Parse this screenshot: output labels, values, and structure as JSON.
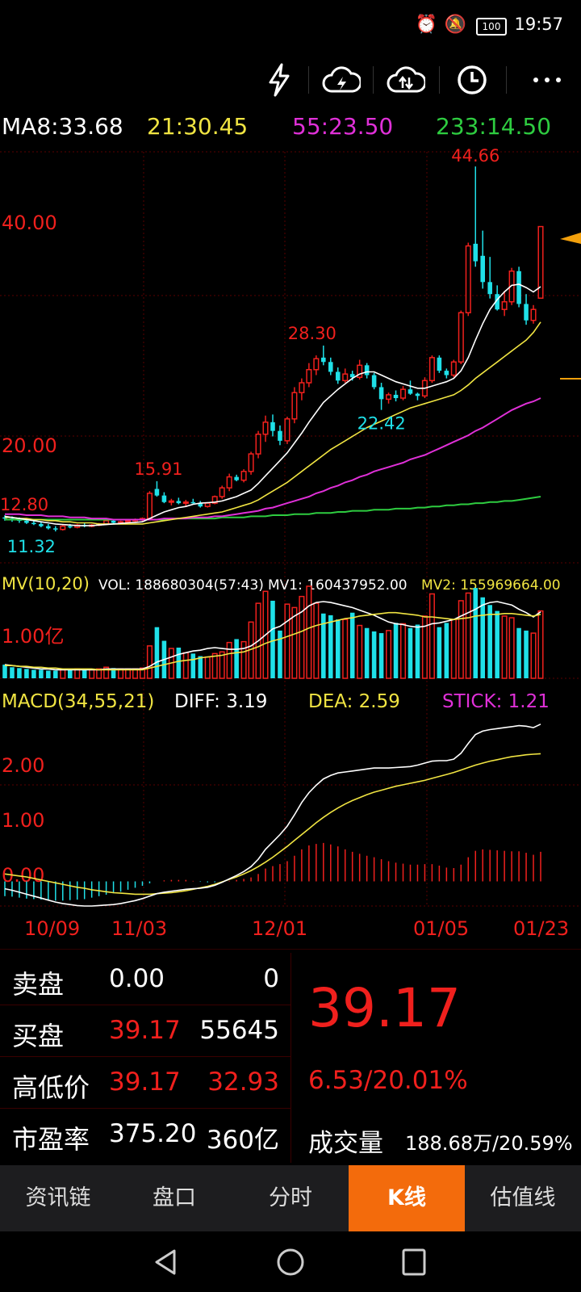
{
  "status": {
    "time": "19:57",
    "battery": "100"
  },
  "toolbar": {
    "icons": [
      "flash-icon",
      "cloud-lightning-icon",
      "cloud-sync-icon",
      "clock-icon",
      "more-icon"
    ]
  },
  "ma_legend": {
    "ma8": "MA8:33.68",
    "ma21": "21:30.45",
    "ma55": "55:23.50",
    "ma233": "233:14.50"
  },
  "price_axis": {
    "top": "40.00",
    "mid": "20.00"
  },
  "annotations": {
    "high": "44.66",
    "peak1": "28.30",
    "low1": "22.42",
    "peak0": "15.91",
    "start": "12.80",
    "low0": "11.32"
  },
  "volume": {
    "title": "MV(10,20)",
    "vol": "VOL: 188680304(57:43)",
    "mv1": "MV1: 160437952.00",
    "mv2": "MV2: 155969664.00",
    "axis": "1.00亿"
  },
  "macd": {
    "title": "MACD(34,55,21)",
    "diff": "DIFF: 3.19",
    "dea": "DEA: 2.59",
    "stick": "STICK: 1.21",
    "axis": [
      "2.00",
      "1.00",
      "0.00"
    ]
  },
  "dates": [
    "10/09",
    "11/03",
    "12/01",
    "01/05",
    "01/23"
  ],
  "quote": {
    "rows": [
      {
        "label": "卖盘",
        "v1": "0.00",
        "v2": "0"
      },
      {
        "label": "买盘",
        "v1": "39.17",
        "v2": "55645"
      },
      {
        "label": "高低价",
        "v1": "39.17",
        "v2": "32.93"
      },
      {
        "label": "市盈率",
        "v1": "375.20",
        "v2": "360亿"
      }
    ],
    "price": "39.17",
    "change": "6.53/20.01%",
    "volume_label": "成交量",
    "volume_value": "188.68万/20.59%"
  },
  "tabs": [
    "资讯链",
    "盘口",
    "分时",
    "K线",
    "估值线"
  ],
  "active_tab": 3,
  "colors": {
    "up": "#f0201d",
    "down": "#1fe0e8",
    "ma21": "#f0e442",
    "ma55": "#e030d8",
    "ma233": "#2ecc40",
    "accent": "#f36b0c"
  },
  "chart_data": {
    "type": "candlestick",
    "ylim": [
      10,
      46
    ],
    "candles": [
      [
        12.6,
        12.8,
        12.3,
        12.5
      ],
      [
        12.5,
        12.7,
        12.2,
        12.4
      ],
      [
        12.4,
        12.6,
        12.1,
        12.3
      ],
      [
        12.3,
        12.5,
        12.0,
        12.1
      ],
      [
        12.1,
        12.3,
        11.9,
        12.0
      ],
      [
        12.0,
        12.2,
        11.7,
        11.8
      ],
      [
        11.8,
        12.0,
        11.5,
        11.6
      ],
      [
        11.6,
        11.8,
        11.32,
        11.5
      ],
      [
        11.5,
        11.9,
        11.4,
        11.8
      ],
      [
        11.8,
        12.0,
        11.6,
        11.7
      ],
      [
        11.7,
        12.0,
        11.6,
        11.9
      ],
      [
        11.9,
        12.1,
        11.7,
        11.8
      ],
      [
        11.8,
        12.0,
        11.7,
        11.9
      ],
      [
        11.9,
        12.1,
        11.8,
        12.0
      ],
      [
        12.0,
        12.4,
        11.9,
        12.3
      ],
      [
        12.3,
        12.4,
        12.0,
        12.1
      ],
      [
        12.1,
        12.3,
        12.0,
        12.2
      ],
      [
        12.2,
        12.4,
        12.1,
        12.3
      ],
      [
        12.3,
        12.5,
        12.1,
        12.4
      ],
      [
        12.4,
        12.6,
        12.2,
        12.5
      ],
      [
        12.5,
        15.0,
        12.4,
        14.8
      ],
      [
        15.2,
        15.91,
        14.5,
        14.6
      ],
      [
        14.6,
        14.9,
        13.9,
        14.0
      ],
      [
        14.0,
        14.3,
        13.7,
        14.1
      ],
      [
        14.1,
        14.4,
        13.8,
        13.9
      ],
      [
        13.9,
        14.2,
        13.6,
        14.0
      ],
      [
        14.0,
        14.3,
        13.8,
        13.9
      ],
      [
        13.9,
        14.1,
        13.5,
        13.6
      ],
      [
        13.6,
        14.0,
        13.5,
        13.9
      ],
      [
        13.9,
        14.6,
        13.8,
        14.5
      ],
      [
        14.5,
        15.5,
        14.3,
        15.3
      ],
      [
        15.3,
        16.6,
        15.0,
        16.3
      ],
      [
        16.3,
        16.5,
        15.9,
        16.0
      ],
      [
        16.0,
        17.0,
        15.8,
        16.8
      ],
      [
        16.8,
        18.6,
        16.5,
        18.4
      ],
      [
        18.4,
        20.5,
        18.0,
        20.2
      ],
      [
        20.2,
        21.9,
        19.5,
        21.3
      ],
      [
        21.3,
        22.0,
        20.0,
        20.5
      ],
      [
        20.5,
        21.0,
        19.2,
        19.6
      ],
      [
        19.6,
        21.8,
        19.3,
        21.6
      ],
      [
        21.6,
        24.5,
        21.2,
        24.0
      ],
      [
        24.0,
        25.3,
        23.3,
        24.9
      ],
      [
        24.9,
        26.7,
        24.5,
        26.1
      ],
      [
        26.1,
        27.4,
        25.6,
        27.1
      ],
      [
        27.2,
        28.3,
        26.5,
        26.8
      ],
      [
        26.8,
        27.2,
        25.6,
        25.9
      ],
      [
        25.9,
        26.3,
        24.8,
        25.1
      ],
      [
        25.1,
        26.2,
        24.9,
        25.7
      ],
      [
        25.7,
        26.0,
        25.1,
        25.4
      ],
      [
        25.4,
        27.0,
        25.2,
        26.5
      ],
      [
        26.5,
        26.7,
        25.3,
        25.6
      ],
      [
        25.6,
        25.8,
        24.3,
        24.5
      ],
      [
        24.5,
        24.9,
        22.42,
        23.4
      ],
      [
        23.4,
        24.0,
        23.0,
        23.8
      ],
      [
        23.8,
        24.2,
        23.2,
        23.5
      ],
      [
        23.5,
        24.6,
        23.3,
        24.3
      ],
      [
        24.3,
        25.1,
        23.8,
        23.9
      ],
      [
        23.9,
        24.0,
        23.3,
        23.7
      ],
      [
        23.7,
        25.4,
        23.5,
        25.1
      ],
      [
        25.1,
        27.4,
        24.9,
        27.2
      ],
      [
        27.2,
        27.4,
        25.8,
        26.0
      ],
      [
        26.0,
        26.2,
        25.3,
        25.6
      ],
      [
        25.6,
        27.0,
        25.4,
        26.8
      ],
      [
        26.8,
        31.5,
        26.6,
        31.3
      ],
      [
        31.3,
        37.7,
        31.0,
        37.4
      ],
      [
        37.6,
        44.66,
        35.5,
        36.0
      ],
      [
        36.5,
        38.8,
        33.5,
        34.1
      ],
      [
        34.1,
        36.4,
        32.6,
        33.0
      ],
      [
        33.0,
        33.8,
        31.5,
        31.6
      ],
      [
        31.6,
        33.3,
        31.0,
        32.3
      ],
      [
        32.3,
        35.4,
        32.0,
        35.1
      ],
      [
        35.1,
        35.5,
        31.8,
        32.1
      ],
      [
        32.1,
        33.0,
        30.2,
        30.6
      ],
      [
        30.6,
        32.0,
        30.3,
        31.6
      ],
      [
        32.63,
        39.17,
        32.63,
        39.17
      ]
    ],
    "ma8": [
      12.7,
      12.6,
      12.5,
      12.4,
      12.3,
      12.2,
      12.1,
      12.0,
      11.95,
      11.9,
      11.85,
      11.85,
      11.85,
      11.9,
      11.95,
      12.0,
      12.05,
      12.1,
      12.15,
      12.2,
      12.5,
      12.8,
      13.1,
      13.3,
      13.5,
      13.6,
      13.8,
      13.9,
      13.95,
      14.0,
      14.1,
      14.3,
      14.5,
      14.8,
      15.1,
      15.7,
      16.4,
      17.1,
      17.8,
      18.5,
      19.4,
      20.3,
      21.3,
      22.2,
      23.1,
      23.7,
      24.3,
      24.8,
      25.3,
      25.7,
      25.9,
      25.9,
      25.6,
      25.3,
      25.0,
      24.8,
      24.6,
      24.4,
      24.4,
      24.6,
      24.8,
      25.0,
      25.3,
      26.0,
      27.2,
      28.8,
      30.3,
      31.6,
      32.5,
      33.2,
      33.8,
      33.9,
      33.6,
      33.2,
      33.68
    ],
    "ma21": [
      12.6,
      12.6,
      12.5,
      12.5,
      12.4,
      12.4,
      12.3,
      12.3,
      12.2,
      12.2,
      12.1,
      12.1,
      12.1,
      12.0,
      12.0,
      12.0,
      12.0,
      12.0,
      12.0,
      12.0,
      12.1,
      12.2,
      12.3,
      12.4,
      12.5,
      12.6,
      12.7,
      12.8,
      12.9,
      13.0,
      13.1,
      13.3,
      13.5,
      13.7,
      13.9,
      14.2,
      14.6,
      15.0,
      15.4,
      15.8,
      16.3,
      16.8,
      17.3,
      17.8,
      18.3,
      18.8,
      19.2,
      19.6,
      20.0,
      20.4,
      20.8,
      21.1,
      21.4,
      21.7,
      22.0,
      22.3,
      22.6,
      22.8,
      23.0,
      23.2,
      23.4,
      23.6,
      23.8,
      24.2,
      24.7,
      25.3,
      25.8,
      26.3,
      26.8,
      27.3,
      27.8,
      28.3,
      28.8,
      29.5,
      30.45
    ],
    "ma55": [
      12.9,
      12.9,
      12.9,
      12.8,
      12.8,
      12.8,
      12.7,
      12.7,
      12.7,
      12.6,
      12.6,
      12.6,
      12.5,
      12.5,
      12.5,
      12.4,
      12.4,
      12.4,
      12.4,
      12.4,
      12.4,
      12.4,
      12.5,
      12.5,
      12.5,
      12.5,
      12.6,
      12.6,
      12.6,
      12.7,
      12.7,
      12.8,
      12.9,
      13.0,
      13.1,
      13.2,
      13.4,
      13.5,
      13.7,
      13.9,
      14.1,
      14.3,
      14.5,
      14.8,
      15.0,
      15.3,
      15.5,
      15.8,
      16.0,
      16.3,
      16.5,
      16.8,
      17.0,
      17.2,
      17.4,
      17.6,
      17.9,
      18.1,
      18.3,
      18.6,
      18.9,
      19.2,
      19.5,
      19.8,
      20.1,
      20.5,
      20.8,
      21.2,
      21.6,
      22.0,
      22.4,
      22.7,
      23.0,
      23.2,
      23.5
    ],
    "ma233": [
      12.4,
      12.4,
      12.4,
      12.4,
      12.4,
      12.4,
      12.4,
      12.4,
      12.4,
      12.4,
      12.4,
      12.4,
      12.4,
      12.4,
      12.4,
      12.4,
      12.4,
      12.4,
      12.4,
      12.4,
      12.4,
      12.4,
      12.4,
      12.5,
      12.5,
      12.5,
      12.5,
      12.5,
      12.5,
      12.5,
      12.6,
      12.6,
      12.6,
      12.6,
      12.7,
      12.7,
      12.7,
      12.8,
      12.8,
      12.8,
      12.9,
      12.9,
      12.9,
      13.0,
      13.0,
      13.0,
      13.1,
      13.1,
      13.2,
      13.2,
      13.2,
      13.3,
      13.3,
      13.3,
      13.4,
      13.4,
      13.4,
      13.5,
      13.5,
      13.6,
      13.6,
      13.7,
      13.7,
      13.8,
      13.8,
      13.9,
      13.9,
      14.0,
      14.0,
      14.1,
      14.1,
      14.2,
      14.3,
      14.4,
      14.5
    ],
    "volume": [
      1.6,
      1.3,
      1.2,
      1.1,
      1.0,
      1.0,
      0.9,
      0.9,
      1.0,
      1.0,
      1.1,
      1.0,
      1.0,
      1.1,
      1.3,
      1.2,
      1.1,
      1.1,
      1.1,
      1.2,
      3.8,
      6.0,
      4.4,
      3.5,
      3.6,
      3.0,
      2.9,
      2.6,
      2.5,
      2.9,
      3.1,
      4.2,
      4.6,
      4.3,
      6.6,
      8.8,
      10.2,
      9.1,
      5.6,
      8.7,
      8.3,
      9.6,
      10.8,
      8.8,
      7.6,
      7.4,
      6.9,
      6.9,
      7.7,
      6.2,
      5.9,
      5.5,
      5.3,
      5.6,
      6.5,
      6.4,
      5.9,
      6.3,
      7.3,
      9.9,
      6.0,
      6.5,
      6.9,
      9.1,
      10.0,
      10.6,
      9.5,
      8.6,
      7.9,
      7.3,
      7.1,
      5.9,
      5.6,
      5.3,
      7.9
    ],
    "mv1": [
      1.6,
      1.5,
      1.4,
      1.3,
      1.2,
      1.1,
      1.1,
      1.0,
      1.0,
      1.0,
      1.0,
      1.0,
      1.0,
      1.0,
      1.1,
      1.1,
      1.1,
      1.1,
      1.1,
      1.1,
      1.4,
      1.9,
      2.2,
      2.5,
      2.8,
      3.0,
      3.2,
      3.3,
      3.5,
      3.6,
      3.5,
      3.4,
      3.4,
      3.5,
      3.8,
      4.4,
      5.1,
      5.8,
      6.1,
      6.7,
      7.3,
      7.8,
      8.5,
      8.9,
      9.0,
      8.9,
      8.7,
      8.5,
      8.3,
      8.0,
      7.7,
      7.4,
      7.0,
      6.6,
      6.4,
      6.3,
      6.1,
      6.0,
      6.1,
      6.4,
      6.5,
      6.7,
      6.9,
      7.3,
      7.7,
      8.1,
      8.6,
      8.9,
      9.0,
      8.8,
      8.6,
      8.1,
      7.7,
      7.2,
      7.8
    ],
    "mv2": [
      1.5,
      1.5,
      1.4,
      1.4,
      1.3,
      1.3,
      1.2,
      1.2,
      1.1,
      1.1,
      1.1,
      1.1,
      1.1,
      1.0,
      1.0,
      1.0,
      1.0,
      1.0,
      1.0,
      1.0,
      1.2,
      1.4,
      1.6,
      1.8,
      2.0,
      2.1,
      2.2,
      2.4,
      2.5,
      2.6,
      2.7,
      2.9,
      3.0,
      3.1,
      3.4,
      3.7,
      4.1,
      4.4,
      4.6,
      4.9,
      5.2,
      5.5,
      5.9,
      6.2,
      6.4,
      6.6,
      6.8,
      7.0,
      7.1,
      7.3,
      7.4,
      7.5,
      7.6,
      7.7,
      7.7,
      7.6,
      7.5,
      7.4,
      7.2,
      7.2,
      7.1,
      7.0,
      6.9,
      7.0,
      7.1,
      7.3,
      7.4,
      7.5,
      7.5,
      7.6,
      7.6,
      7.5,
      7.4,
      7.3,
      7.5
    ],
    "macd_diff": [
      -0.15,
      -0.18,
      -0.22,
      -0.26,
      -0.3,
      -0.34,
      -0.38,
      -0.42,
      -0.45,
      -0.47,
      -0.49,
      -0.5,
      -0.5,
      -0.49,
      -0.48,
      -0.47,
      -0.45,
      -0.42,
      -0.39,
      -0.35,
      -0.3,
      -0.25,
      -0.22,
      -0.2,
      -0.18,
      -0.16,
      -0.15,
      -0.14,
      -0.12,
      -0.08,
      -0.02,
      0.05,
      0.12,
      0.2,
      0.3,
      0.45,
      0.65,
      0.8,
      0.95,
      1.12,
      1.35,
      1.6,
      1.8,
      1.95,
      2.08,
      2.15,
      2.2,
      2.22,
      2.24,
      2.26,
      2.28,
      2.3,
      2.3,
      2.3,
      2.31,
      2.32,
      2.33,
      2.36,
      2.4,
      2.44,
      2.45,
      2.45,
      2.48,
      2.6,
      2.8,
      2.98,
      3.05,
      3.08,
      3.1,
      3.12,
      3.14,
      3.16,
      3.15,
      3.12,
      3.19
    ],
    "macd_dea": [
      0.15,
      0.13,
      0.11,
      0.09,
      0.06,
      0.03,
      0.0,
      -0.03,
      -0.06,
      -0.09,
      -0.12,
      -0.14,
      -0.17,
      -0.19,
      -0.21,
      -0.23,
      -0.24,
      -0.25,
      -0.26,
      -0.26,
      -0.26,
      -0.25,
      -0.24,
      -0.23,
      -0.21,
      -0.19,
      -0.16,
      -0.13,
      -0.1,
      -0.06,
      -0.01,
      0.04,
      0.09,
      0.15,
      0.22,
      0.3,
      0.39,
      0.49,
      0.6,
      0.71,
      0.83,
      0.95,
      1.07,
      1.19,
      1.3,
      1.4,
      1.49,
      1.57,
      1.64,
      1.7,
      1.76,
      1.81,
      1.85,
      1.89,
      1.93,
      1.96,
      1.99,
      2.02,
      2.05,
      2.09,
      2.13,
      2.17,
      2.21,
      2.26,
      2.31,
      2.36,
      2.4,
      2.44,
      2.47,
      2.5,
      2.53,
      2.55,
      2.57,
      2.58,
      2.59
    ],
    "macd_ylim": [
      -0.5,
      3.4
    ]
  }
}
